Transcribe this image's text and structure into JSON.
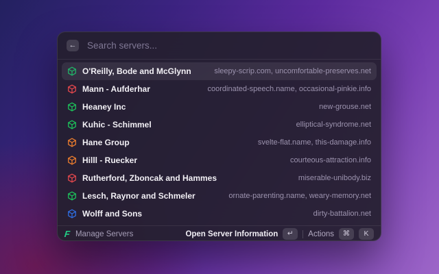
{
  "window": {
    "search": {
      "placeholder": "Search servers...",
      "value": ""
    },
    "icons": {
      "back": "←",
      "enter": "↵",
      "cmd": "⌘"
    },
    "list": {
      "items": [
        {
          "name": "O'Reilly, Bode and McGlynn",
          "domains": "sleepy-scrip.com, uncomfortable-preserves.net",
          "icon": "cube-icon",
          "icon_color": "#21b568",
          "selected": true
        },
        {
          "name": "Mann - Aufderhar",
          "domains": "coordinated-speech.name, occasional-pinkie.info",
          "icon": "cube-icon",
          "icon_color": "#e5484d",
          "selected": false
        },
        {
          "name": "Heaney Inc",
          "domains": "new-grouse.net",
          "icon": "cube-icon",
          "icon_color": "#1dc35b",
          "selected": false
        },
        {
          "name": "Kuhic - Schimmel",
          "domains": "elliptical-syndrome.net",
          "icon": "cube-icon",
          "icon_color": "#1dc35b",
          "selected": false
        },
        {
          "name": "Hane Group",
          "domains": "svelte-flat.name, this-damage.info",
          "icon": "cube-icon",
          "icon_color": "#ee7e2e",
          "selected": false
        },
        {
          "name": "Hilll - Ruecker",
          "domains": "courteous-attraction.info",
          "icon": "cube-icon",
          "icon_color": "#ee7e2e",
          "selected": false
        },
        {
          "name": "Rutherford, Zboncak and Hammes",
          "domains": "miserable-unibody.biz",
          "icon": "cube-icon",
          "icon_color": "#e5484d",
          "selected": false
        },
        {
          "name": "Lesch, Raynor and Schmeler",
          "domains": "ornate-parenting.name, weary-memory.net",
          "icon": "cube-icon",
          "icon_color": "#1dc35b",
          "selected": false
        },
        {
          "name": "Wolff and Sons",
          "domains": "dirty-battalion.net",
          "icon": "cube-icon",
          "icon_color": "#2f6fe4",
          "selected": false
        }
      ]
    },
    "footer": {
      "logo_glyph": "F",
      "logo_color": "#22cf85",
      "left_label": "Manage Servers",
      "primary_action": "Open Server Information",
      "primary_key": "↵",
      "secondary_action": "Actions",
      "secondary_keys": [
        "⌘",
        "K"
      ]
    }
  }
}
